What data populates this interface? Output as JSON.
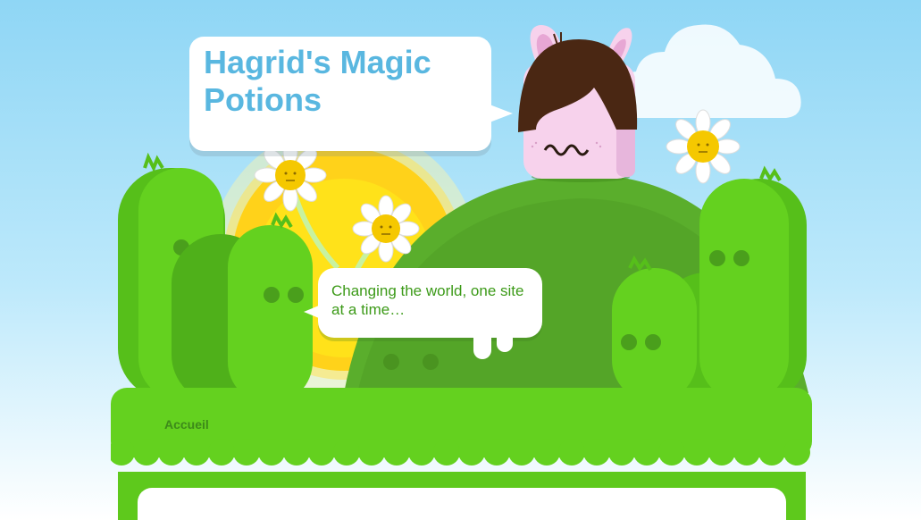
{
  "header": {
    "site_title": "Hagrid's Magic Potions",
    "tagline": "Changing the world, one site at a time…"
  },
  "nav": {
    "items": [
      {
        "label": "Accueil"
      }
    ]
  },
  "colors": {
    "sky_top": "#8fd6f5",
    "title_blue": "#59b7e0",
    "grass_green": "#64d11f",
    "hill_green": "#5aae2c",
    "tagline_green": "#3c9a18",
    "nav_text": "#3d8a1a",
    "sun_yellow": "#ffd21a",
    "mascot_pink": "#f7d2ec",
    "mascot_hair": "#4a2713"
  },
  "decorations": {
    "mascot": "pink-bunny-mascot-with-brown-hair",
    "flowers": "daisy-flower-icons",
    "sun": "sun-icon",
    "cloud": "cloud-icon",
    "cacti": "cactus-creature-icons"
  }
}
